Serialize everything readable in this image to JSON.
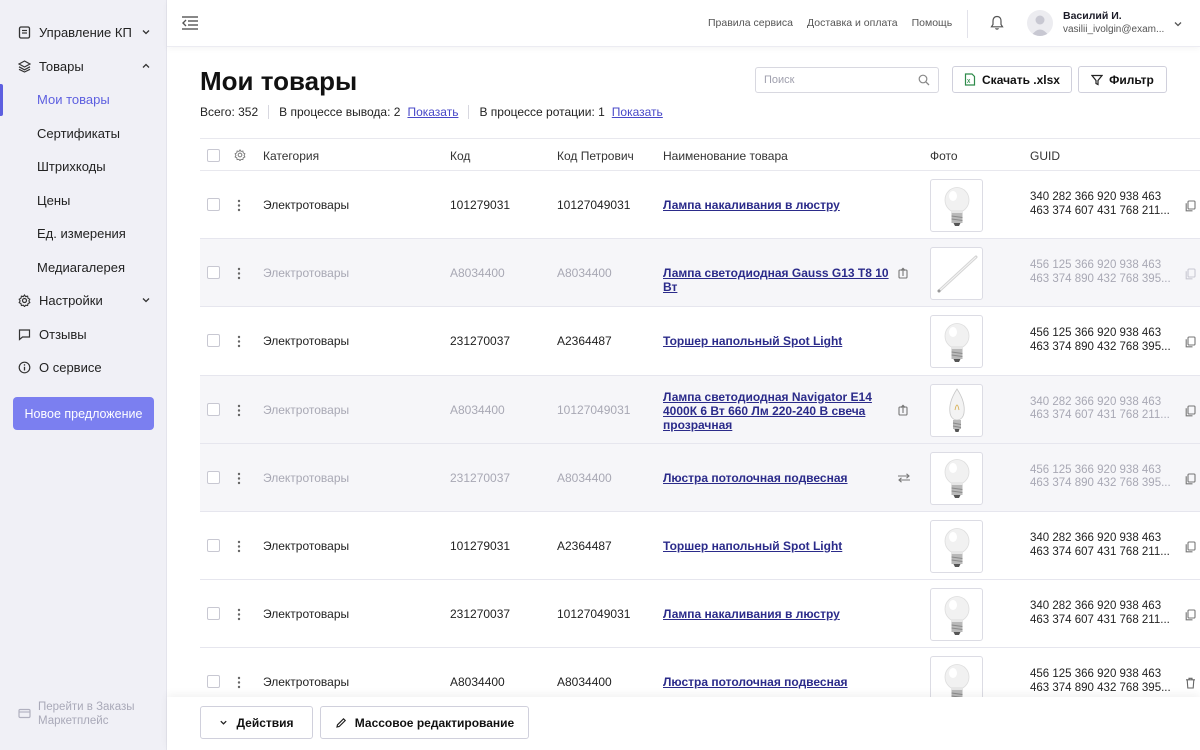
{
  "sidebar": {
    "items": [
      {
        "label": "Управление КП",
        "icon": "document-icon"
      },
      {
        "label": "Товары",
        "icon": "layers-icon"
      },
      {
        "label": "Мои товары"
      },
      {
        "label": "Сертификаты"
      },
      {
        "label": "Штрихкоды"
      },
      {
        "label": "Цены"
      },
      {
        "label": "Ед. измерения"
      },
      {
        "label": "Медиагалерея"
      },
      {
        "label": "Настройки",
        "icon": "gear-icon"
      },
      {
        "label": "Отзывы",
        "icon": "chat-icon"
      },
      {
        "label": "О сервисе",
        "icon": "info-icon"
      }
    ],
    "new_offer": "Новое предложение",
    "market_link": "Перейти в Заказы Маркетплейс"
  },
  "header": {
    "links": [
      "Правила сервиса",
      "Доставка и оплата",
      "Помощь"
    ],
    "user_name": "Василий И.",
    "user_email": "vasilii_ivolgin@exam..."
  },
  "page": {
    "title": "Мои товары",
    "total": "Всего: 352",
    "withdrawal": "В процессе вывода: 2",
    "rotation": "В процессе ротации: 1",
    "show": "Показать",
    "search_placeholder": "Поиск",
    "download": "Скачать .xlsx",
    "filter": "Фильтр"
  },
  "table": {
    "headers": {
      "category": "Категория",
      "code": "Код",
      "petrovich": "Код Петрович",
      "name": "Наименование товара",
      "photo": "Фото",
      "guid": "GUID"
    },
    "rows": [
      {
        "category": "Электротовары",
        "code": "101279031",
        "petrovich": "10127049031",
        "name": "Лампа накаливания в люстру",
        "guid1": "340 282 366 920 938 463",
        "guid2": "463 374 607 431 768 211...",
        "photo": "bulb-icon"
      },
      {
        "category": "Электротовары",
        "code": "A8034400",
        "petrovich": "A8034400",
        "name": "Лампа светодиодная Gauss G13 T8 10 Вт",
        "guid1": "456 125 366 920 938 463",
        "guid2": "463 374 890 432 768 395...",
        "photo": "tube-lamp-icon"
      },
      {
        "category": "Электротовары",
        "code": "231270037",
        "petrovich": "A2364487",
        "name": "Торшер напольный Spot Light",
        "guid1": "456 125 366 920 938 463",
        "guid2": "463 374 890 432 768 395...",
        "photo": "bulb-icon"
      },
      {
        "category": "Электротовары",
        "code": "A8034400",
        "petrovich": "10127049031",
        "name": "Лампа светодиодная Navigator E14 4000К 6 Вт 660 Лм 220-240 В свеча прозрачная",
        "guid1": "340 282 366 920 938 463",
        "guid2": "463 374 607 431 768 211...",
        "photo": "candle-bulb-icon"
      },
      {
        "category": "Электротовары",
        "code": "231270037",
        "petrovich": "A8034400",
        "name": "Люстра потолочная подвесная",
        "guid1": "456 125 366 920 938 463",
        "guid2": "463 374 890 432 768 395...",
        "photo": "bulb-icon"
      },
      {
        "category": "Электротовары",
        "code": "101279031",
        "petrovich": "A2364487",
        "name": "Торшер напольный Spot Light",
        "guid1": "340 282 366 920 938 463",
        "guid2": "463 374 607 431 768 211...",
        "photo": "bulb-icon"
      },
      {
        "category": "Электротовары",
        "code": "231270037",
        "petrovich": "10127049031",
        "name": "Лампа накаливания в люстру",
        "guid1": "340 282 366 920 938 463",
        "guid2": "463 374 607 431 768 211...",
        "photo": "bulb-icon"
      },
      {
        "category": "Электротовары",
        "code": "A8034400",
        "petrovich": "A8034400",
        "name": "Люстра потолочная подвесная",
        "guid1": "456 125 366 920 938 463",
        "guid2": "463 374 890 432 768 395...",
        "photo": "bulb-icon"
      }
    ]
  },
  "footer": {
    "actions": "Действия",
    "mass_edit": "Массовое редактирование"
  },
  "colors": {
    "accent": "#5d5fe0",
    "button": "#7b7ff0",
    "link": "#2b2b8a"
  }
}
